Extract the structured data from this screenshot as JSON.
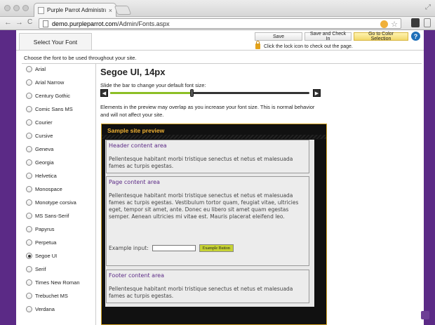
{
  "browser": {
    "tab_title": "Purple Parrot Administrati",
    "tab_close": "×",
    "url_host": "demo.purpleparrot.com",
    "url_path": "/Admin/Fonts.aspx",
    "back": "←",
    "forward": "→",
    "reload": "C"
  },
  "header": {
    "select_tab": "Select Your Font",
    "save_label": "Save",
    "save_checkin_label": "Save and Check In",
    "color_selection_label": "Go to Color Selection",
    "help_label": "?",
    "lock_note": "Click the lock icon to check out the page."
  },
  "instruction": "Choose the font to be used throughout your site.",
  "fonts": [
    {
      "label": "Arial",
      "checked": false
    },
    {
      "label": "Arial Narrow",
      "checked": false
    },
    {
      "label": "Century Gothic",
      "checked": false
    },
    {
      "label": "Comic Sans MS",
      "checked": false
    },
    {
      "label": "Courier",
      "checked": false
    },
    {
      "label": "Cursive",
      "checked": false
    },
    {
      "label": "Geneva",
      "checked": false
    },
    {
      "label": "Georgia",
      "checked": false
    },
    {
      "label": "Helvetica",
      "checked": false
    },
    {
      "label": "Monospace",
      "checked": false
    },
    {
      "label": "Monotype corsiva",
      "checked": false
    },
    {
      "label": "MS Sans-Serif",
      "checked": false
    },
    {
      "label": "Papyrus",
      "checked": false
    },
    {
      "label": "Perpetua",
      "checked": false
    },
    {
      "label": "Segoe UI",
      "checked": true
    },
    {
      "label": "Serif",
      "checked": false
    },
    {
      "label": "Times New Roman",
      "checked": false
    },
    {
      "label": "Trebuchet MS",
      "checked": false
    },
    {
      "label": "Verdana",
      "checked": false
    }
  ],
  "main": {
    "heading": "Segoe UI, 14px",
    "slider_label": "Slide the bar to change your default font size:",
    "slider_level": 0.41,
    "slider_left": "◀",
    "slider_right": "▶",
    "warning": "Elements in the preview may overlap as you increase your font size. This is normal behavior and will not affect your site."
  },
  "preview": {
    "title": "Sample site preview",
    "header_title": "Header content area",
    "header_text": "Pellentesque habitant morbi tristique senectus et netus et malesuada fames ac turpis egestas.",
    "page_title": "Page content area",
    "page_text": "Pellentesque habitant morbi tristique senectus et netus et malesuada fames ac turpis egestas. Vestibulum tortor quam, feugiat vitae, ultricies eget, tempor sit amet, ante. Donec eu libero sit amet quam egestas semper. Aenean ultricies mi vitae est. Mauris placerat eleifend leo.",
    "example_input_label": "Example input:",
    "example_button_label": "Example Button",
    "footer_title": "Footer content area",
    "footer_text": "Pellentesque habitant morbi tristique senectus et netus et malesuada fames ac turpis egestas."
  },
  "colors": {
    "accent_purple": "#5b2a86",
    "preview_title": "#f2b233",
    "slider_fill": "#8cbf26"
  }
}
